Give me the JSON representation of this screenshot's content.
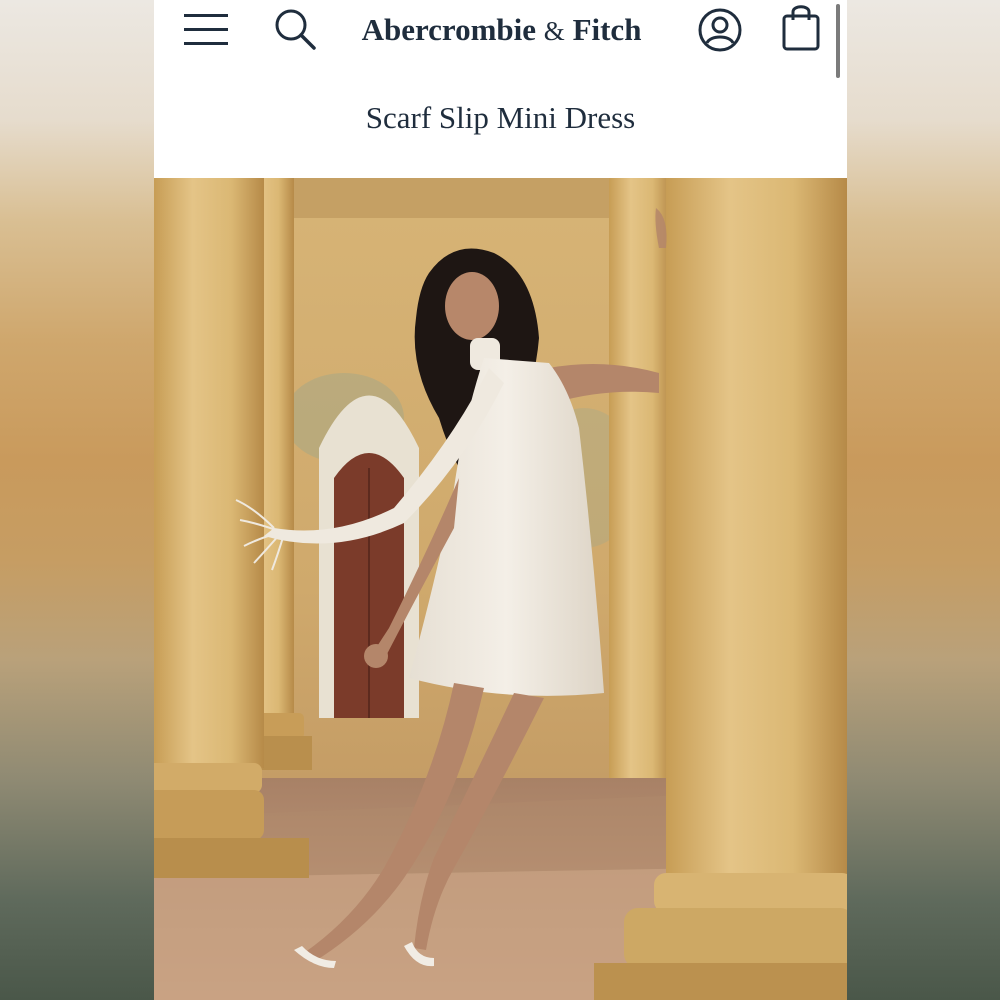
{
  "header": {
    "brand_left": "Abercrombie",
    "brand_amp": "&",
    "brand_right": "Fitch",
    "menu_icon": "hamburger-menu-icon",
    "search_icon": "search-icon",
    "account_icon": "account-icon",
    "bag_icon": "shopping-bag-icon"
  },
  "product": {
    "title": "Scarf Slip Mini Dress"
  },
  "colors": {
    "text": "#1f2d3d",
    "column": "#d9b873",
    "dress": "#efe9df"
  }
}
